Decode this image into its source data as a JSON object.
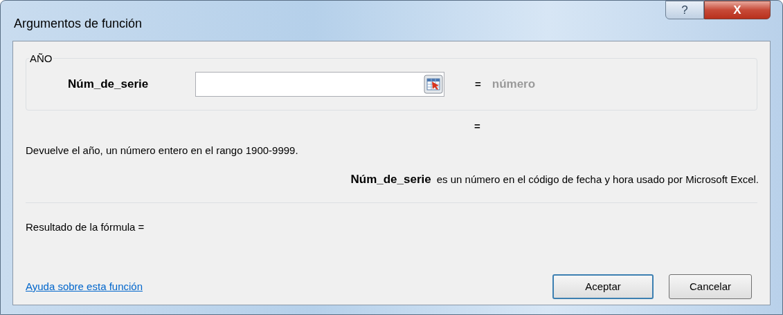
{
  "window": {
    "title": "Argumentos de función",
    "help_button": "?",
    "close_button": "X"
  },
  "group": {
    "title": "AÑO",
    "argument": {
      "label": "Núm_de_serie",
      "equals": "=",
      "result": "número"
    }
  },
  "total_equals": "=",
  "description": "Devuelve el año, un número entero en el rango 1900-9999.",
  "argument_help": {
    "name": "Núm_de_serie",
    "text": "es un número en el código de fecha y hora usado por Microsoft Excel."
  },
  "formula_result": "Resultado de la fórmula =",
  "help_link": "Ayuda sobre esta función",
  "buttons": [
    {
      "label": "Aceptar",
      "default": true
    },
    {
      "label": "Cancelar",
      "default": false
    }
  ]
}
